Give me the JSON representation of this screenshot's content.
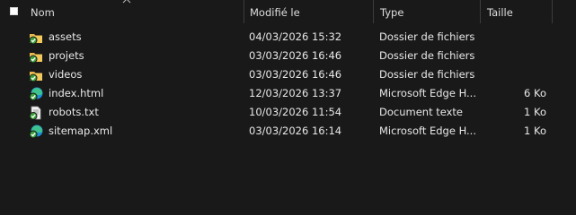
{
  "columns": {
    "name": "Nom",
    "modified": "Modifié le",
    "type": "Type",
    "size": "Taille"
  },
  "files": [
    {
      "name": "assets",
      "modified": "04/03/2026 15:32",
      "type": "Dossier de fichiers",
      "size": "",
      "icon": "folder-synced-icon"
    },
    {
      "name": "projets",
      "modified": "03/03/2026 16:46",
      "type": "Dossier de fichiers",
      "size": "",
      "icon": "folder-synced-icon"
    },
    {
      "name": "videos",
      "modified": "03/03/2026 16:46",
      "type": "Dossier de fichiers",
      "size": "",
      "icon": "folder-synced-icon"
    },
    {
      "name": "index.html",
      "modified": "12/03/2026 13:37",
      "type": "Microsoft Edge H...",
      "size": "6 Ko",
      "icon": "edge-html-synced-icon"
    },
    {
      "name": "robots.txt",
      "modified": "10/03/2026 11:54",
      "type": "Document texte",
      "size": "1 Ko",
      "icon": "text-document-synced-icon"
    },
    {
      "name": "sitemap.xml",
      "modified": "03/03/2026 16:14",
      "type": "Microsoft Edge H...",
      "size": "1 Ko",
      "icon": "edge-html-synced-icon"
    }
  ],
  "colors": {
    "background": "#191919",
    "folder": "#e8b94a",
    "sync_check": "#3aa13a"
  }
}
